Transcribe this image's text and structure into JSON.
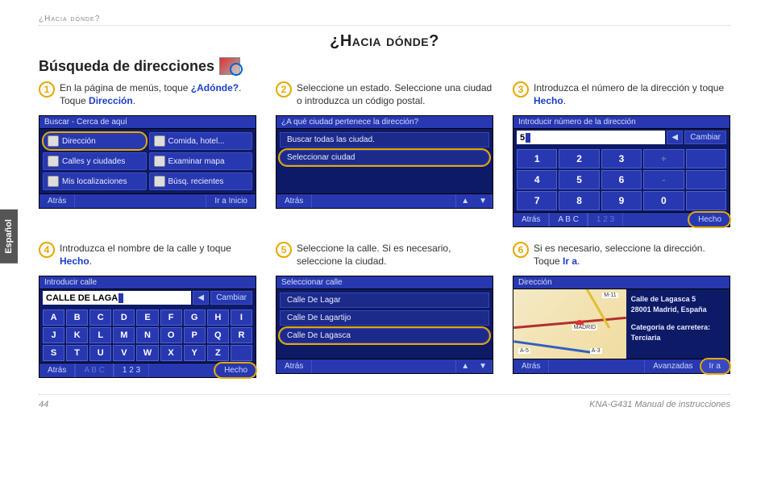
{
  "header_small": "¿Hacia dónde?",
  "main_title": "¿Hacia dónde?",
  "section_title": "Búsqueda de direcciones",
  "side_tab": "Español",
  "footer": {
    "page": "44",
    "manual": "KNA-G431 Manual de instrucciones"
  },
  "steps": [
    {
      "num": "1",
      "text_pre": "En la página de menús, toque ",
      "hl1": "¿Adónde?",
      "text_mid": ". Toque ",
      "hl2": "Dirección",
      "text_post": "."
    },
    {
      "num": "2",
      "text_pre": "Seleccione un estado. Seleccione una ciudad o introduzca un código postal.",
      "hl1": "",
      "text_mid": "",
      "hl2": "",
      "text_post": ""
    },
    {
      "num": "3",
      "text_pre": "Introduzca el número de la dirección y toque ",
      "hl1": "Hecho",
      "text_mid": ".",
      "hl2": "",
      "text_post": ""
    },
    {
      "num": "4",
      "text_pre": "Introduzca el nombre de la calle y toque ",
      "hl1": "Hecho",
      "text_mid": ".",
      "hl2": "",
      "text_post": ""
    },
    {
      "num": "5",
      "text_pre": "Seleccione la calle. Si es necesario, seleccione la ciudad.",
      "hl1": "",
      "text_mid": "",
      "hl2": "",
      "text_post": ""
    },
    {
      "num": "6",
      "text_pre": "Si es necesario, seleccione la dirección. Toque ",
      "hl1": "Ir a",
      "text_mid": ".",
      "hl2": "",
      "text_post": ""
    }
  ],
  "screen1": {
    "title": "Buscar - Cerca de aquí",
    "items": [
      "Dirección",
      "Comida, hotel...",
      "Calles y ciudades",
      "Examinar mapa",
      "Mis localizaciones",
      "Búsq. recientes"
    ],
    "back": "Atrás",
    "home": "Ir a Inicio"
  },
  "screen2": {
    "title": "¿A qué ciudad pertenece la dirección?",
    "items": [
      "Buscar todas las ciudad.",
      "Seleccionar ciudad"
    ],
    "back": "Atrás"
  },
  "screen3": {
    "title": "Introducir número de la dirección",
    "value": "5",
    "change": "Cambiar",
    "keys": [
      "1",
      "2",
      "3",
      "+",
      "",
      "4",
      "5",
      "6",
      "-",
      "",
      "7",
      "8",
      "9",
      "0",
      ""
    ],
    "back": "Atrás",
    "abc": "A B C",
    "num": "1 2 3",
    "done": "Hecho"
  },
  "screen4": {
    "title": "Introducir calle",
    "value": "CALLE DE LAGA",
    "change": "Cambiar",
    "letters": [
      "A",
      "B",
      "C",
      "D",
      "E",
      "F",
      "G",
      "H",
      "I",
      "J",
      "K",
      "L",
      "M",
      "N",
      "O",
      "P",
      "Q",
      "R",
      "S",
      "T",
      "U",
      "V",
      "W",
      "X",
      "Y",
      "Z",
      "",
      ""
    ],
    "back": "Atrás",
    "abc": "A B C",
    "num": "1 2 3",
    "done": "Hecho"
  },
  "screen5": {
    "title": "Seleccionar calle",
    "items": [
      "Calle De Lagar",
      "Calle De Lagartijo",
      "Calle De Lagasca"
    ],
    "back": "Atrás"
  },
  "screen6": {
    "title": "Dirección",
    "addr1": "Calle de Lagasca 5",
    "addr2": "28001 Madrid, España",
    "cat_lbl": "Categoría de carretera:",
    "cat_val": "Terciaria",
    "back": "Atrás",
    "adv": "Avanzadas",
    "go": "Ir a",
    "map_labels": [
      "M-11",
      "MADRID",
      "A-5",
      "A-3"
    ]
  }
}
